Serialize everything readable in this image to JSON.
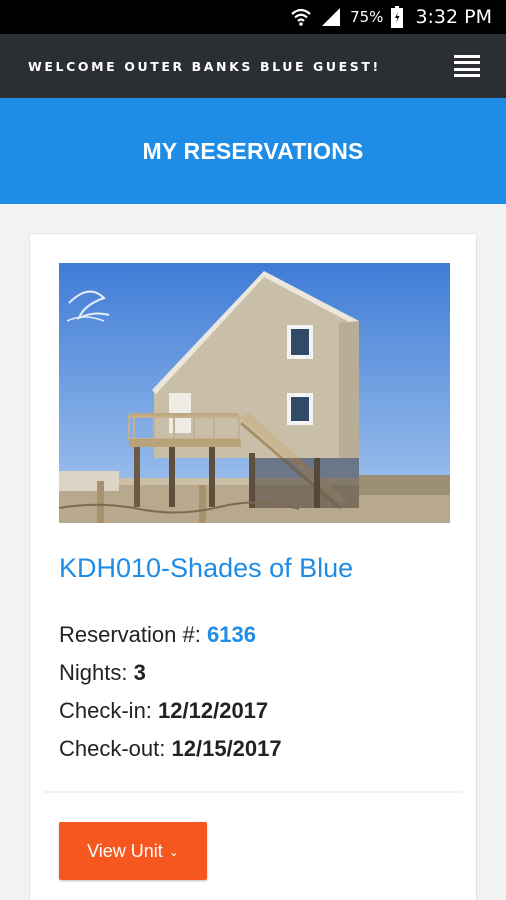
{
  "status_bar": {
    "battery_percent": "75%",
    "time": "3:32 PM",
    "icons": [
      "wifi-icon",
      "signal-icon",
      "battery-icon"
    ]
  },
  "header": {
    "welcome_text": "WELCOME OUTER BANKS BLUE GUEST!",
    "menu_icon": "hamburger-menu-icon"
  },
  "banner": {
    "title": "MY RESERVATIONS"
  },
  "reservation": {
    "unit_name": "KDH010-Shades of Blue",
    "reservation_label": "Reservation #:",
    "reservation_number": "6136",
    "nights_label": "Nights:",
    "nights": "3",
    "checkin_label": "Check-in:",
    "checkin": "12/12/2017",
    "checkout_label": "Check-out:",
    "checkout": "12/15/2017",
    "view_button": "View Unit"
  },
  "colors": {
    "accent_blue": "#1f8ce6",
    "header_dark": "#2b2f33",
    "button_orange": "#f5571f"
  }
}
